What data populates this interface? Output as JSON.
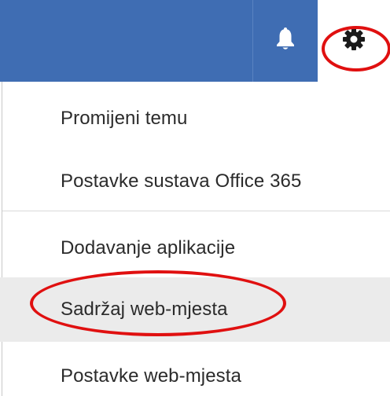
{
  "header": {
    "bell_icon": "bell-icon",
    "gear_icon": "gear-icon"
  },
  "menu": {
    "items": [
      {
        "label": "Promijeni temu"
      },
      {
        "label": "Postavke sustava Office 365"
      },
      {
        "label": "Dodavanje aplikacije"
      },
      {
        "label": "Sadržaj web-mjesta",
        "selected": true
      },
      {
        "label": "Postavke web-mjesta"
      }
    ]
  },
  "colors": {
    "header_blue": "#3f6db3",
    "highlight_red": "#e01010",
    "selected_bg": "#ebebeb"
  }
}
